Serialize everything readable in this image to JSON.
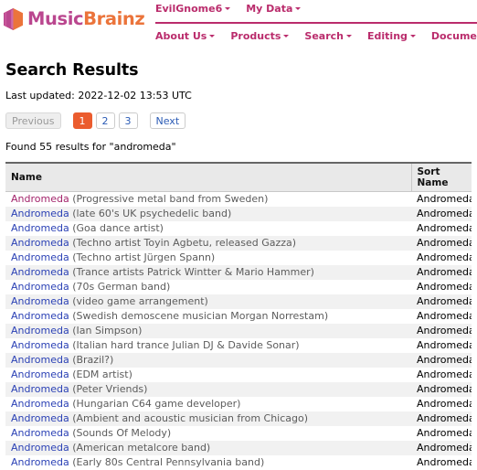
{
  "brand": {
    "name_part1": "Music",
    "name_part2": "Brainz",
    "logo_icon": "musicbrainz-cube-icon",
    "color_magenta": "#BA478F",
    "color_orange": "#EB743B",
    "color_nav": "#BA2C6C"
  },
  "top_nav": [
    {
      "label": "EvilGnome6",
      "icon": "chevron-down-icon"
    },
    {
      "label": "My Data",
      "icon": "chevron-down-icon"
    }
  ],
  "main_nav": [
    {
      "label": "About Us",
      "icon": "chevron-down-icon"
    },
    {
      "label": "Products",
      "icon": "chevron-down-icon"
    },
    {
      "label": "Search",
      "icon": "chevron-down-icon"
    },
    {
      "label": "Editing",
      "icon": "chevron-down-icon"
    },
    {
      "label": "Documentation",
      "icon": "chevron-down-icon"
    }
  ],
  "page": {
    "title": "Search Results",
    "last_updated": "Last updated: 2022-12-02 13:53 UTC",
    "results_count": "Found 55 results for \"andromeda\""
  },
  "pagination": {
    "previous_label": "Previous",
    "next_label": "Next",
    "pages": [
      "1",
      "2",
      "3"
    ],
    "current_page": "1",
    "active_color": "#EB5C2E"
  },
  "table": {
    "columns": [
      "Name",
      "Sort Name"
    ],
    "rows": [
      {
        "name": "Andromeda",
        "comment": "(Progressive metal band from Sweden)",
        "sort_name": "Andromeda",
        "visited": true
      },
      {
        "name": "Andromeda",
        "comment": "(late 60's UK psychedelic band)",
        "sort_name": "Andromeda",
        "visited": false
      },
      {
        "name": "Andromeda",
        "comment": "(Goa dance artist)",
        "sort_name": "Andromeda",
        "visited": false
      },
      {
        "name": "Andromeda",
        "comment": "(Techno artist Toyin Agbetu, released Gazza)",
        "sort_name": "Andromeda",
        "visited": false
      },
      {
        "name": "Andromeda",
        "comment": "(Techno artist Jürgen Spann)",
        "sort_name": "Andromeda",
        "visited": false
      },
      {
        "name": "Andromeda",
        "comment": "(Trance artists Patrick Wintter & Mario Hammer)",
        "sort_name": "Andromeda",
        "visited": false
      },
      {
        "name": "Andromeda",
        "comment": "(70s German band)",
        "sort_name": "Andromeda",
        "visited": false
      },
      {
        "name": "Andromeda",
        "comment": "(video game arrangement)",
        "sort_name": "Andromeda",
        "visited": false
      },
      {
        "name": "Andromeda",
        "comment": "(Swedish demoscene musician Morgan Norrestam)",
        "sort_name": "Andromeda",
        "visited": false
      },
      {
        "name": "Andromeda",
        "comment": "(Ian Simpson)",
        "sort_name": "Andromeda",
        "visited": false
      },
      {
        "name": "Andromeda",
        "comment": "(Italian hard trance Julian DJ & Davide Sonar)",
        "sort_name": "Andromeda",
        "visited": false
      },
      {
        "name": "Andromeda",
        "comment": "(Brazil?)",
        "sort_name": "Andromeda",
        "visited": false
      },
      {
        "name": "Andromeda",
        "comment": "(EDM artist)",
        "sort_name": "Andromeda",
        "visited": false
      },
      {
        "name": "Andromeda",
        "comment": "(Peter Vriends)",
        "sort_name": "Andromeda",
        "visited": false
      },
      {
        "name": "Andromeda",
        "comment": "(Hungarian C64 game developer)",
        "sort_name": "Andromeda",
        "visited": false
      },
      {
        "name": "Andromeda",
        "comment": "(Ambient and acoustic musician from Chicago)",
        "sort_name": "Andromeda",
        "visited": false
      },
      {
        "name": "Andromeda",
        "comment": "(Sounds Of Melody)",
        "sort_name": "Andromeda",
        "visited": false
      },
      {
        "name": "Andromeda",
        "comment": "(American metalcore band)",
        "sort_name": "Andromeda",
        "visited": false
      },
      {
        "name": "Andromeda",
        "comment": "(Early 80s Central Pennsylvania band)",
        "sort_name": "Andromeda",
        "visited": false
      }
    ]
  }
}
